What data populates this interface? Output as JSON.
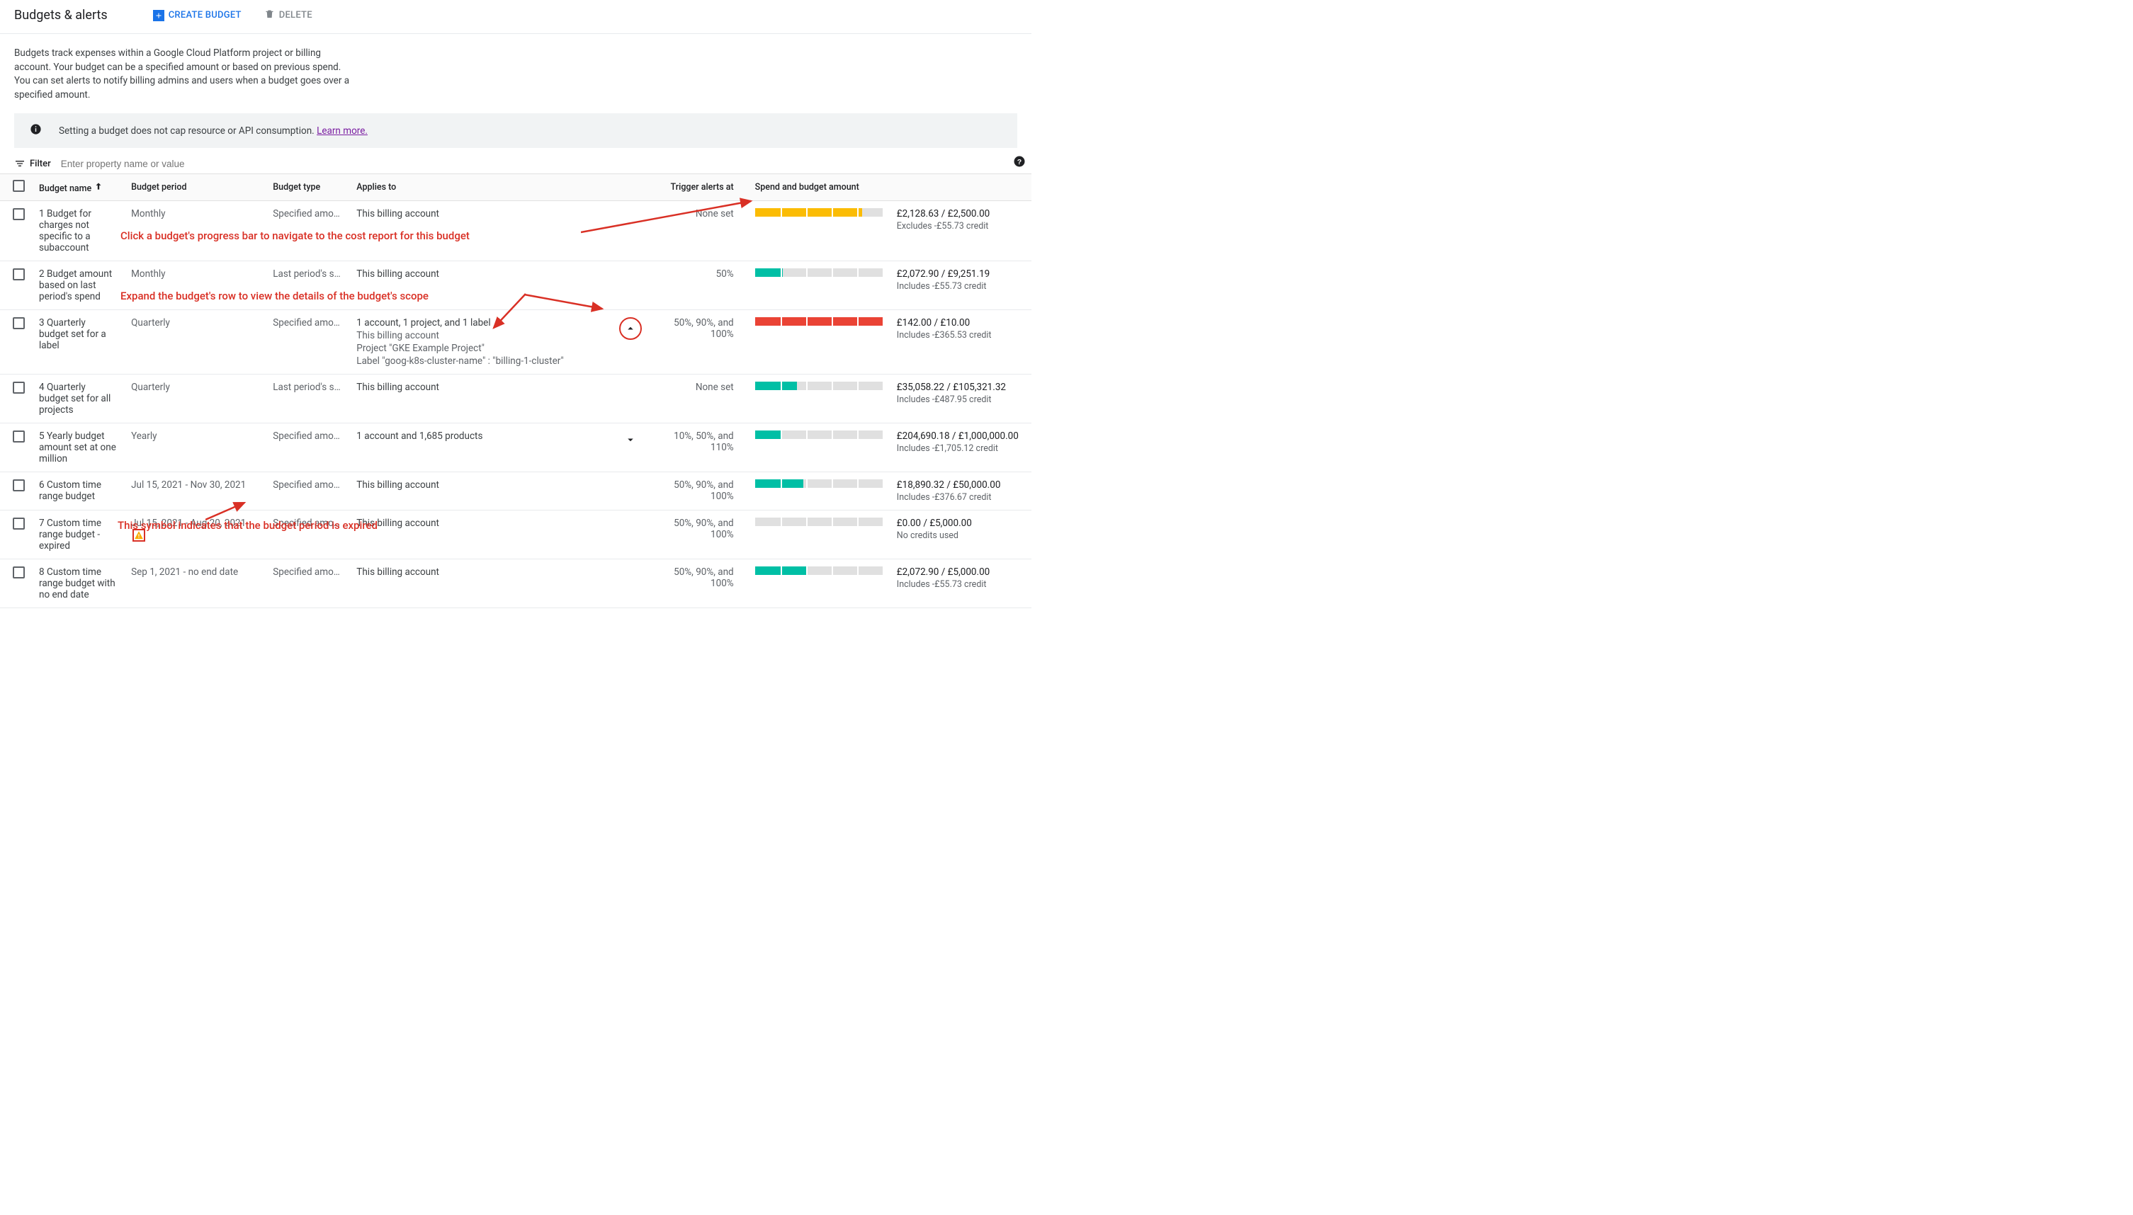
{
  "header": {
    "title": "Budgets & alerts",
    "create_label": "Create budget",
    "delete_label": "Delete"
  },
  "intro_text": "Budgets track expenses within a Google Cloud Platform project or billing account. Your budget can be a specified amount or based on previous spend. You can set alerts to notify billing admins and users when a budget goes over a specified amount.",
  "info_banner": {
    "text": "Setting a budget does not cap resource or API consumption. ",
    "link": "Learn more."
  },
  "filter": {
    "label": "Filter",
    "placeholder": "Enter property name or value"
  },
  "columns": {
    "name": "Budget name",
    "period": "Budget period",
    "type": "Budget type",
    "applies": "Applies to",
    "trigger": "Trigger alerts at",
    "spend": "Spend and budget amount"
  },
  "rows": [
    {
      "name": "1 Budget for charges not specific to a subaccount",
      "period": "Monthly",
      "type": "Specified amo…",
      "applies": [
        "This billing account"
      ],
      "expand": "",
      "trigger": "None set",
      "bar_fill": 84,
      "bar_color": "amber",
      "amt_main": "£2,128.63 / £2,500.00",
      "amt_sub": "Excludes -£55.73 credit"
    },
    {
      "name": "2 Budget amount based on last period's spend",
      "period": "Monthly",
      "type": "Last period's s…",
      "applies": [
        "This billing account"
      ],
      "expand": "",
      "trigger": "50%",
      "bar_fill": 22,
      "bar_color": "teal",
      "amt_main": "£2,072.90 / £9,251.19",
      "amt_sub": "Includes -£55.73 credit"
    },
    {
      "name": "3 Quarterly budget set for a label",
      "period": "Quarterly",
      "type": "Specified amo…",
      "applies": [
        "1 account, 1 project, and 1 label",
        "This billing account",
        "Project \"GKE Example Project\"",
        "Label \"goog-k8s-cluster-name\" : \"billing-1-cluster\""
      ],
      "expand": "up-circled",
      "trigger": "50%, 90%, and 100%",
      "bar_fill": 100,
      "bar_color": "red",
      "amt_main": "£142.00 / £10.00",
      "amt_sub": "Includes -£365.53 credit"
    },
    {
      "name": "4 Quarterly budget set for all projects",
      "period": "Quarterly",
      "type": "Last period's s…",
      "applies": [
        "This billing account"
      ],
      "expand": "",
      "trigger": "None set",
      "bar_fill": 33,
      "bar_color": "teal",
      "amt_main": "£35,058.22 / £105,321.32",
      "amt_sub": "Includes -£487.95 credit"
    },
    {
      "name": "5 Yearly budget amount set at one million",
      "period": "Yearly",
      "type": "Specified amo…",
      "applies": [
        "1 account and 1,685 products"
      ],
      "expand": "down",
      "trigger": "10%, 50%, and 110%",
      "bar_fill": 20,
      "bar_color": "teal",
      "amt_main": "£204,690.18 / £1,000,000.00",
      "amt_sub": "Includes -£1,705.12 credit"
    },
    {
      "name": "6 Custom time range budget",
      "period": "Jul 15, 2021 - Nov 30, 2021",
      "type": "Specified amo…",
      "applies": [
        "This billing account"
      ],
      "expand": "",
      "trigger": "50%, 90%, and 100%",
      "bar_fill": 38,
      "bar_color": "teal",
      "amt_main": "£18,890.32 / £50,000.00",
      "amt_sub": "Includes -£376.67 credit"
    },
    {
      "name": "7 Custom time range budget - expired",
      "period": "Jul 15, 2021 - Aug 20, 2021",
      "period_expired": true,
      "type": "Specified amo…",
      "applies": [
        "This billing account"
      ],
      "expand": "",
      "trigger": "50%, 90%, and 100%",
      "bar_fill": 0,
      "bar_color": "teal",
      "amt_main": "£0.00 / £5,000.00",
      "amt_sub": "No credits used"
    },
    {
      "name": "8 Custom time range budget with no end date",
      "period": "Sep 1, 2021 - no end date",
      "type": "Specified amo…",
      "applies": [
        "This billing account"
      ],
      "expand": "",
      "trigger": "50%, 90%, and 100%",
      "bar_fill": 41,
      "bar_color": "teal",
      "amt_main": "£2,072.90 / £5,000.00",
      "amt_sub": "Includes -£55.73 credit"
    }
  ],
  "annotations": {
    "a1": "Click a budget's progress bar to navigate to the cost report for this budget",
    "a2": "Expand the budget's row to view the details of the budget's scope",
    "a3": "This symbol indicates that the budget period is expired"
  }
}
